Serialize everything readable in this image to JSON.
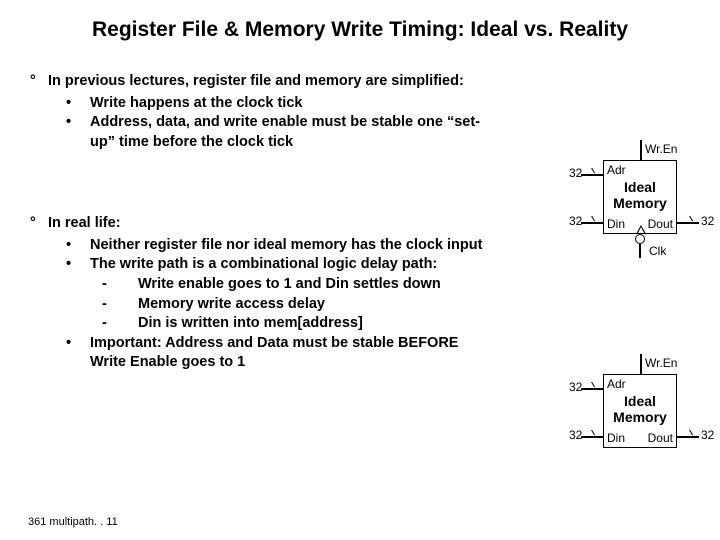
{
  "title": "Register File & Memory Write Timing: Ideal vs. Reality",
  "section1": {
    "main": "In previous lectures, register file and memory are simplified:",
    "b1": "Write happens at the clock tick",
    "b2": "Address, data, and write enable must be stable one “set-up” time before the clock tick"
  },
  "section2": {
    "main": "In real life:",
    "b1": "Neither register file nor ideal memory has the clock input",
    "b2": "The write path  is a combinational logic delay path:",
    "s1": "Write enable goes to 1 and Din settles down",
    "s2": "Memory write access delay",
    "s3": "Din is written into mem[address]",
    "b3": "Important: Address and Data must be stable BEFORE Write Enable goes to 1"
  },
  "mem": {
    "wren": "Wr.En",
    "adr": "Adr",
    "ideal": "Ideal",
    "memory": "Memory",
    "din": "Din",
    "dout": "Dout",
    "clk": "Clk",
    "w": "32"
  },
  "footer": "361 multipath. . 11"
}
